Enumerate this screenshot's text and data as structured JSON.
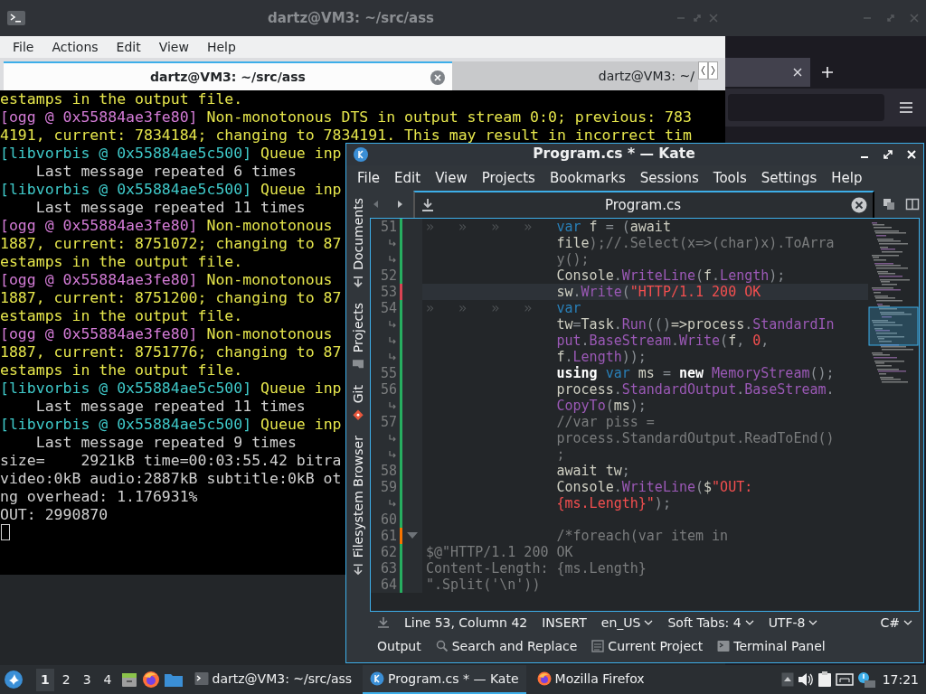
{
  "terminal": {
    "title": "dartz@VM3: ~/src/ass",
    "menu": [
      "File",
      "Actions",
      "Edit",
      "View",
      "Help"
    ],
    "tabs": [
      {
        "label": "dartz@VM3: ~/src/ass",
        "selected": true
      },
      {
        "label": "dartz@VM3: ~/",
        "selected": false
      }
    ],
    "lines": [
      {
        "kind": "warn",
        "text": "estamps in the output file."
      },
      {
        "kind": "ogg",
        "tag": "[ogg @ 0x55884ae3fe80]",
        "text": " Non-monotonous DTS in output stream 0:0; previous: 783"
      },
      {
        "kind": "warn",
        "text": "4191, current: 7834184; changing to 7834191. This may result in incorrect tim"
      },
      {
        "kind": "vorbis",
        "tag": "[libvorbis @ 0x55884ae5c500]",
        "text": " Queue inp"
      },
      {
        "kind": "info",
        "text": "    Last message repeated 6 times"
      },
      {
        "kind": "vorbis",
        "tag": "[libvorbis @ 0x55884ae5c500]",
        "text": " Queue inp"
      },
      {
        "kind": "info",
        "text": "    Last message repeated 11 times"
      },
      {
        "kind": "ogg",
        "tag": "[ogg @ 0x55884ae3fe80]",
        "text": " Non-monotonous"
      },
      {
        "kind": "warn",
        "text": "1887, current: 8751072; changing to 87"
      },
      {
        "kind": "warn",
        "text": "estamps in the output file."
      },
      {
        "kind": "ogg",
        "tag": "[ogg @ 0x55884ae3fe80]",
        "text": " Non-monotonous"
      },
      {
        "kind": "warn",
        "text": "1887, current: 8751200; changing to 87"
      },
      {
        "kind": "warn",
        "text": "estamps in the output file."
      },
      {
        "kind": "ogg",
        "tag": "[ogg @ 0x55884ae3fe80]",
        "text": " Non-monotonous"
      },
      {
        "kind": "warn",
        "text": "1887, current: 8751776; changing to 87"
      },
      {
        "kind": "warn",
        "text": "estamps in the output file."
      },
      {
        "kind": "vorbis",
        "tag": "[libvorbis @ 0x55884ae5c500]",
        "text": " Queue inp"
      },
      {
        "kind": "info",
        "text": "    Last message repeated 11 times"
      },
      {
        "kind": "vorbis",
        "tag": "[libvorbis @ 0x55884ae5c500]",
        "text": " Queue inp"
      },
      {
        "kind": "info",
        "text": "    Last message repeated 9 times"
      },
      {
        "kind": "info",
        "text": "size=    2921kB time=00:03:55.42 bitra"
      },
      {
        "kind": "info",
        "text": "video:0kB audio:2887kB subtitle:0kB ot"
      },
      {
        "kind": "info",
        "text": "ng overhead: 1.176931%"
      },
      {
        "kind": "info",
        "text": "OUT: 2990870"
      }
    ]
  },
  "kate": {
    "title": "Program.cs * — Kate",
    "menu": [
      "File",
      "Edit",
      "View",
      "Projects",
      "Bookmarks",
      "Sessions",
      "Tools",
      "Settings",
      "Help"
    ],
    "sidebar": [
      {
        "label": "Documents",
        "kind": "arrow",
        "selected": false
      },
      {
        "label": "Projects",
        "kind": "folder",
        "selected": false
      },
      {
        "label": "Git",
        "kind": "git",
        "selected": false
      },
      {
        "label": "Filesystem Browser",
        "kind": "arrow",
        "selected": false
      }
    ],
    "tab": {
      "label": "Program.cs"
    },
    "lines": [
      {
        "num": "51",
        "color": "#27ae60",
        "current": false,
        "fold": false,
        "indented": true,
        "marks": "»   »   »   »",
        "tokens": [
          {
            "text": "var",
            "kind": "k"
          },
          {
            "text": " f ",
            "kind": "t"
          },
          {
            "text": "= (",
            "kind": "o"
          },
          {
            "text": "await",
            "kind": "t"
          }
        ],
        "wraps": [
          [
            {
              "text": "file",
              "kind": "t"
            },
            {
              "text": ");//.Select(x=>(char)x).ToArra",
              "kind": "c"
            }
          ],
          [
            {
              "text": "y();",
              "kind": "c"
            }
          ]
        ]
      },
      {
        "num": "52",
        "color": "#27ae60",
        "current": false,
        "fold": false,
        "indented": true,
        "tokens": [
          {
            "text": "Console",
            "kind": "t"
          },
          {
            "text": ".",
            "kind": "o"
          },
          {
            "text": "WriteLine",
            "kind": "f"
          },
          {
            "text": "(",
            "kind": "o"
          },
          {
            "text": "f",
            "kind": "t"
          },
          {
            "text": ".",
            "kind": "o"
          },
          {
            "text": "Length",
            "kind": "f"
          },
          {
            "text": ");",
            "kind": "o"
          }
        ]
      },
      {
        "num": "53",
        "color": "#da4453",
        "current": true,
        "fold": false,
        "indented": true,
        "tokens": [
          {
            "text": "sw",
            "kind": "t"
          },
          {
            "text": ".",
            "kind": "o"
          },
          {
            "text": "Write",
            "kind": "f"
          },
          {
            "text": "(",
            "kind": "o"
          },
          {
            "text": "\"HTTP/1.1 200 OK",
            "kind": "s"
          }
        ]
      },
      {
        "num": "54",
        "color": "#27ae60",
        "current": false,
        "fold": false,
        "indented": true,
        "marks": "»   »   »   »",
        "tokens": [
          {
            "text": "var",
            "kind": "k"
          }
        ],
        "wraps": [
          [
            {
              "text": "tw",
              "kind": "t"
            },
            {
              "text": "=",
              "kind": "o"
            },
            {
              "text": "Task",
              "kind": "t"
            },
            {
              "text": ".",
              "kind": "o"
            },
            {
              "text": "Run",
              "kind": "f"
            },
            {
              "text": "(()",
              "kind": "o"
            },
            {
              "text": "=>process",
              "kind": "t"
            },
            {
              "text": ".",
              "kind": "o"
            },
            {
              "text": "StandardIn",
              "kind": "f"
            }
          ],
          [
            {
              "text": "put",
              "kind": "f"
            },
            {
              "text": ".",
              "kind": "o"
            },
            {
              "text": "BaseStream",
              "kind": "f"
            },
            {
              "text": ".",
              "kind": "o"
            },
            {
              "text": "Write",
              "kind": "f"
            },
            {
              "text": "(",
              "kind": "o"
            },
            {
              "text": "f",
              "kind": "t"
            },
            {
              "text": ", ",
              "kind": "o"
            },
            {
              "text": "0",
              "kind": "n"
            },
            {
              "text": ",",
              "kind": "o"
            }
          ],
          [
            {
              "text": "f",
              "kind": "t"
            },
            {
              "text": ".",
              "kind": "o"
            },
            {
              "text": "Length",
              "kind": "f"
            },
            {
              "text": "));",
              "kind": "o"
            }
          ]
        ]
      },
      {
        "num": "55",
        "color": "#27ae60",
        "current": false,
        "fold": false,
        "indented": true,
        "tokens": [
          {
            "text": "using",
            "kind": "b"
          },
          {
            "text": " var",
            "kind": "k"
          },
          {
            "text": " ms ",
            "kind": "t"
          },
          {
            "text": "= ",
            "kind": "o"
          },
          {
            "text": "new",
            "kind": "b"
          },
          {
            "text": " MemoryStream",
            "kind": "f"
          },
          {
            "text": "();",
            "kind": "o"
          }
        ]
      },
      {
        "num": "56",
        "color": "#27ae60",
        "current": false,
        "fold": false,
        "indented": true,
        "tokens": [
          {
            "text": "process",
            "kind": "t"
          },
          {
            "text": ".",
            "kind": "o"
          },
          {
            "text": "StandardOutput",
            "kind": "f"
          },
          {
            "text": ".",
            "kind": "o"
          },
          {
            "text": "BaseStream",
            "kind": "f"
          },
          {
            "text": ".",
            "kind": "o"
          }
        ],
        "wraps": [
          [
            {
              "text": "CopyTo",
              "kind": "f"
            },
            {
              "text": "(",
              "kind": "o"
            },
            {
              "text": "ms",
              "kind": "t"
            },
            {
              "text": ");",
              "kind": "o"
            }
          ]
        ]
      },
      {
        "num": "57",
        "color": "#27ae60",
        "current": false,
        "fold": false,
        "indented": true,
        "tokens": [
          {
            "text": "//var piss =",
            "kind": "c"
          }
        ],
        "wraps": [
          [
            {
              "text": "process.StandardOutput.ReadToEnd()",
              "kind": "c"
            }
          ],
          [
            {
              "text": ";",
              "kind": "c"
            }
          ]
        ]
      },
      {
        "num": "58",
        "color": "#27ae60",
        "current": false,
        "fold": false,
        "indented": true,
        "tokens": [
          {
            "text": "await tw",
            "kind": "t"
          },
          {
            "text": ";",
            "kind": "o"
          }
        ]
      },
      {
        "num": "59",
        "color": "#27ae60",
        "current": false,
        "fold": false,
        "indented": true,
        "tokens": [
          {
            "text": "Console",
            "kind": "t"
          },
          {
            "text": ".",
            "kind": "o"
          },
          {
            "text": "WriteLine",
            "kind": "f"
          },
          {
            "text": "(",
            "kind": "o"
          },
          {
            "text": "$",
            "kind": "t"
          },
          {
            "text": "\"OUT:",
            "kind": "s"
          }
        ],
        "wraps": [
          [
            {
              "text": "{ms.Length}\"",
              "kind": "s"
            },
            {
              "text": ");",
              "kind": "o"
            }
          ]
        ]
      },
      {
        "num": "60",
        "color": "#27ae60",
        "current": false,
        "fold": false
      },
      {
        "num": "61",
        "color": "#f67400",
        "current": false,
        "fold": true,
        "indented": true,
        "tokens": [
          {
            "text": "/*foreach(var item in",
            "kind": "c"
          }
        ]
      },
      {
        "num": "62",
        "color": "#27ae60",
        "current": false,
        "fold": false,
        "indented": false,
        "tokens": [
          {
            "text": "$@\"HTTP/1.1 200 OK",
            "kind": "c"
          }
        ]
      },
      {
        "num": "63",
        "color": "#27ae60",
        "current": false,
        "fold": false,
        "indented": false,
        "tokens": [
          {
            "text": "Content-Length: {ms.Length}",
            "kind": "c"
          }
        ]
      },
      {
        "num": "64",
        "color": "#27ae60",
        "current": false,
        "fold": false,
        "indented": false,
        "tokens": [
          {
            "text": "\".Split('\\n'))",
            "kind": "c"
          }
        ]
      }
    ],
    "status": [
      {
        "label": "Line 53, Column 42",
        "dropdown": false
      },
      {
        "label": "INSERT",
        "dropdown": false
      },
      {
        "label": "en_US",
        "dropdown": true
      },
      {
        "label": "Soft Tabs: 4",
        "dropdown": true
      },
      {
        "label": "UTF-8",
        "dropdown": true
      },
      {
        "label": "C#",
        "dropdown": true
      }
    ],
    "panels": [
      {
        "label": "Output",
        "kind": "none"
      },
      {
        "label": "Search and Replace",
        "kind": "search"
      },
      {
        "label": "Current Project",
        "kind": "project"
      },
      {
        "label": "Terminal Panel",
        "kind": "terminal"
      }
    ]
  },
  "taskbar": {
    "workspaces": [
      {
        "label": "1",
        "selected": true
      },
      {
        "label": "2",
        "selected": false
      },
      {
        "label": "3",
        "selected": false
      },
      {
        "label": "4",
        "selected": false
      }
    ],
    "tasks": [
      {
        "label": "dartz@VM3: ~/src/ass",
        "kind": "terminal",
        "selected": false
      },
      {
        "label": "Program.cs * — Kate",
        "kind": "kate",
        "selected": true
      },
      {
        "label": "Mozilla Firefox",
        "kind": "firefox",
        "selected": false
      }
    ],
    "clock": "17:21"
  }
}
